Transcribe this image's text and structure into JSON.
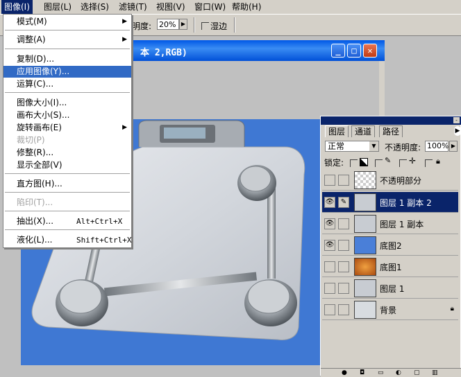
{
  "menubar": {
    "items": [
      {
        "label": "图像(I)",
        "active": true
      },
      {
        "label": "图层(L)"
      },
      {
        "label": "选择(S)"
      },
      {
        "label": "滤镜(T)"
      },
      {
        "label": "视图(V)"
      },
      {
        "label": "窗口(W)"
      },
      {
        "label": "帮助(H)"
      }
    ]
  },
  "options": {
    "opacity_label": "明度:",
    "opacity_value": "20%",
    "blend_label": "湿边"
  },
  "document": {
    "title": "本 2,RGB)"
  },
  "menu": {
    "items": [
      {
        "label": "模式(M)",
        "submenu": true
      },
      {
        "label": "调整(A)",
        "submenu": true
      },
      {
        "label": "复制(D)..."
      },
      {
        "label": "应用图像(Y)...",
        "highlighted": true
      },
      {
        "label": "运算(C)..."
      },
      {
        "label": "图像大小(I)..."
      },
      {
        "label": "画布大小(S)..."
      },
      {
        "label": "旋转画布(E)",
        "submenu": true
      },
      {
        "label": "裁切(P)",
        "disabled": true
      },
      {
        "label": "修整(R)..."
      },
      {
        "label": "显示全部(V)"
      },
      {
        "label": "直方图(H)..."
      },
      {
        "label": "陷印(T)...",
        "disabled": true
      },
      {
        "label": "抽出(X)...",
        "shortcut": "Alt+Ctrl+X"
      },
      {
        "label": "液化(L)...",
        "shortcut": "Shift+Ctrl+X"
      }
    ]
  },
  "layers_panel": {
    "tabs": [
      "图层",
      "通道",
      "路径"
    ],
    "blend_mode": "正常",
    "opacity_label": "不透明度:",
    "opacity_value": "100%",
    "lock_label": "锁定:",
    "layers": [
      {
        "name": "不透明部分",
        "visible": false,
        "thumb": "checker"
      },
      {
        "name": "图层 1 副本 2",
        "visible": true,
        "selected": true,
        "thumb": "scale"
      },
      {
        "name": "图层 1 副本",
        "visible": true,
        "thumb": "scale"
      },
      {
        "name": "底图2",
        "visible": true,
        "thumb": "#4a7fd8"
      },
      {
        "name": "底图1",
        "visible": false,
        "thumb": "#c8641a"
      },
      {
        "name": "图层 1",
        "visible": false,
        "thumb": "scale"
      },
      {
        "name": "背景",
        "visible": false,
        "thumb": "scale",
        "locked": true
      }
    ]
  },
  "colors": {
    "canvas_bg": "#3f78d3",
    "selection": "#0a246a",
    "menu_highlight": "#316ac5"
  }
}
